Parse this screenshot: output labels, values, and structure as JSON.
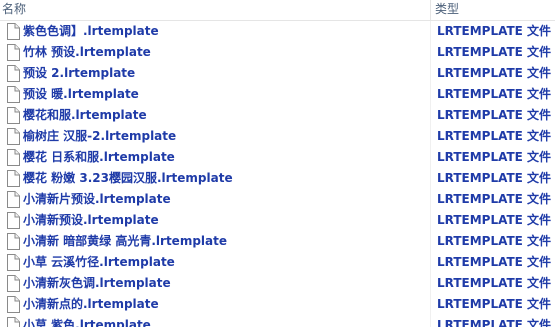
{
  "columns": {
    "name": "名称",
    "type": "类型"
  },
  "files": [
    {
      "name": "紫色色调】.lrtemplate",
      "type": "LRTEMPLATE 文件",
      "icon": "file-icon"
    },
    {
      "name": "竹林 预设.lrtemplate",
      "type": "LRTEMPLATE 文件",
      "icon": "file-icon"
    },
    {
      "name": "预设 2.lrtemplate",
      "type": "LRTEMPLATE 文件",
      "icon": "file-icon"
    },
    {
      "name": "预设 暖.lrtemplate",
      "type": "LRTEMPLATE 文件",
      "icon": "file-icon"
    },
    {
      "name": "樱花和服.lrtemplate",
      "type": "LRTEMPLATE 文件",
      "icon": "file-icon"
    },
    {
      "name": "榆树庄 汉服-2.lrtemplate",
      "type": "LRTEMPLATE 文件",
      "icon": "file-icon"
    },
    {
      "name": "樱花 日系和服.lrtemplate",
      "type": "LRTEMPLATE 文件",
      "icon": "file-icon"
    },
    {
      "name": "樱花 粉嫩 3.23樱园汉服.lrtemplate",
      "type": "LRTEMPLATE 文件",
      "icon": "file-icon"
    },
    {
      "name": "小清新片预设.lrtemplate",
      "type": "LRTEMPLATE 文件",
      "icon": "file-icon"
    },
    {
      "name": "小清新预设.lrtemplate",
      "type": "LRTEMPLATE 文件",
      "icon": "file-icon"
    },
    {
      "name": "小清新 暗部黄绿 高光青.lrtemplate",
      "type": "LRTEMPLATE 文件",
      "icon": "file-icon"
    },
    {
      "name": "小草 云溪竹径.lrtemplate",
      "type": "LRTEMPLATE 文件",
      "icon": "file-icon"
    },
    {
      "name": "小清新灰色调.lrtemplate",
      "type": "LRTEMPLATE 文件",
      "icon": "file-icon"
    },
    {
      "name": "小清新点的.lrtemplate",
      "type": "LRTEMPLATE 文件",
      "icon": "file-icon"
    },
    {
      "name": "小草 紫色.lrtemplate",
      "type": "LRTEMPLATE 文件",
      "icon": "file-icon"
    }
  ],
  "colors": {
    "text_link": "#1f3ba8",
    "header_text": "#4c607a"
  }
}
